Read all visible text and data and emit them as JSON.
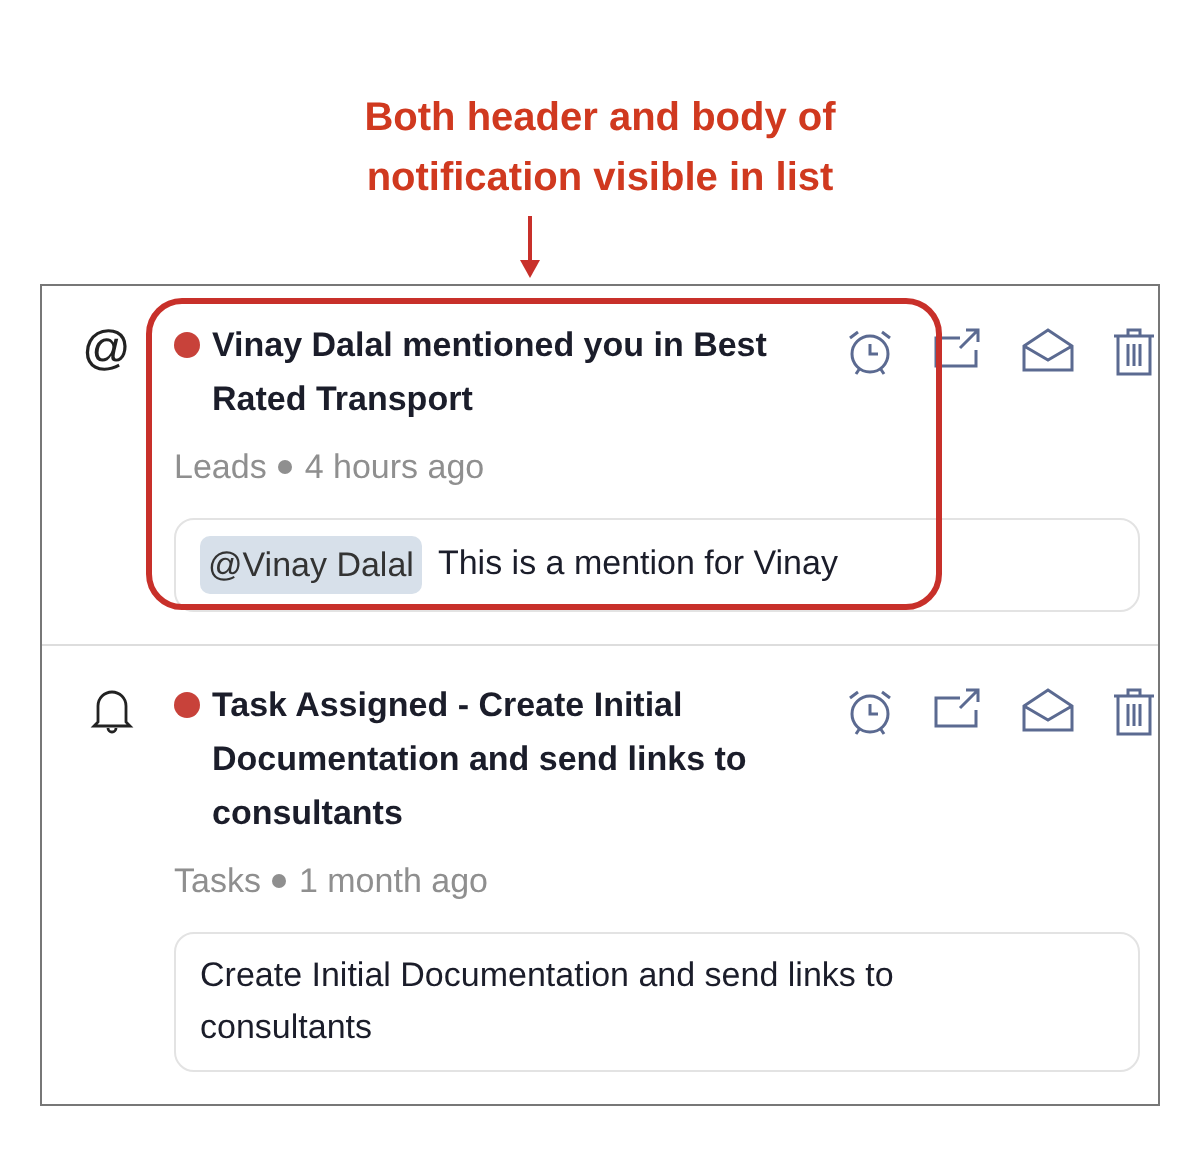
{
  "annotation": {
    "caption": "Both header and body of notification visible in list"
  },
  "notifications": [
    {
      "kind": "mention",
      "symbol": "@",
      "unread": true,
      "title": "Vinay Dalal mentioned you in Best Rated Transport",
      "source": "Leads",
      "time": "4 hours ago",
      "body": {
        "mention": "@Vinay Dalal",
        "text": "This is a mention for Vinay"
      }
    },
    {
      "kind": "task",
      "unread": true,
      "title": "Task Assigned - Create Initial Documentation and send links to consultants",
      "source": "Tasks",
      "time": "1 month ago",
      "body": {
        "text": "Create Initial Documentation and send links to consultants"
      }
    }
  ]
}
